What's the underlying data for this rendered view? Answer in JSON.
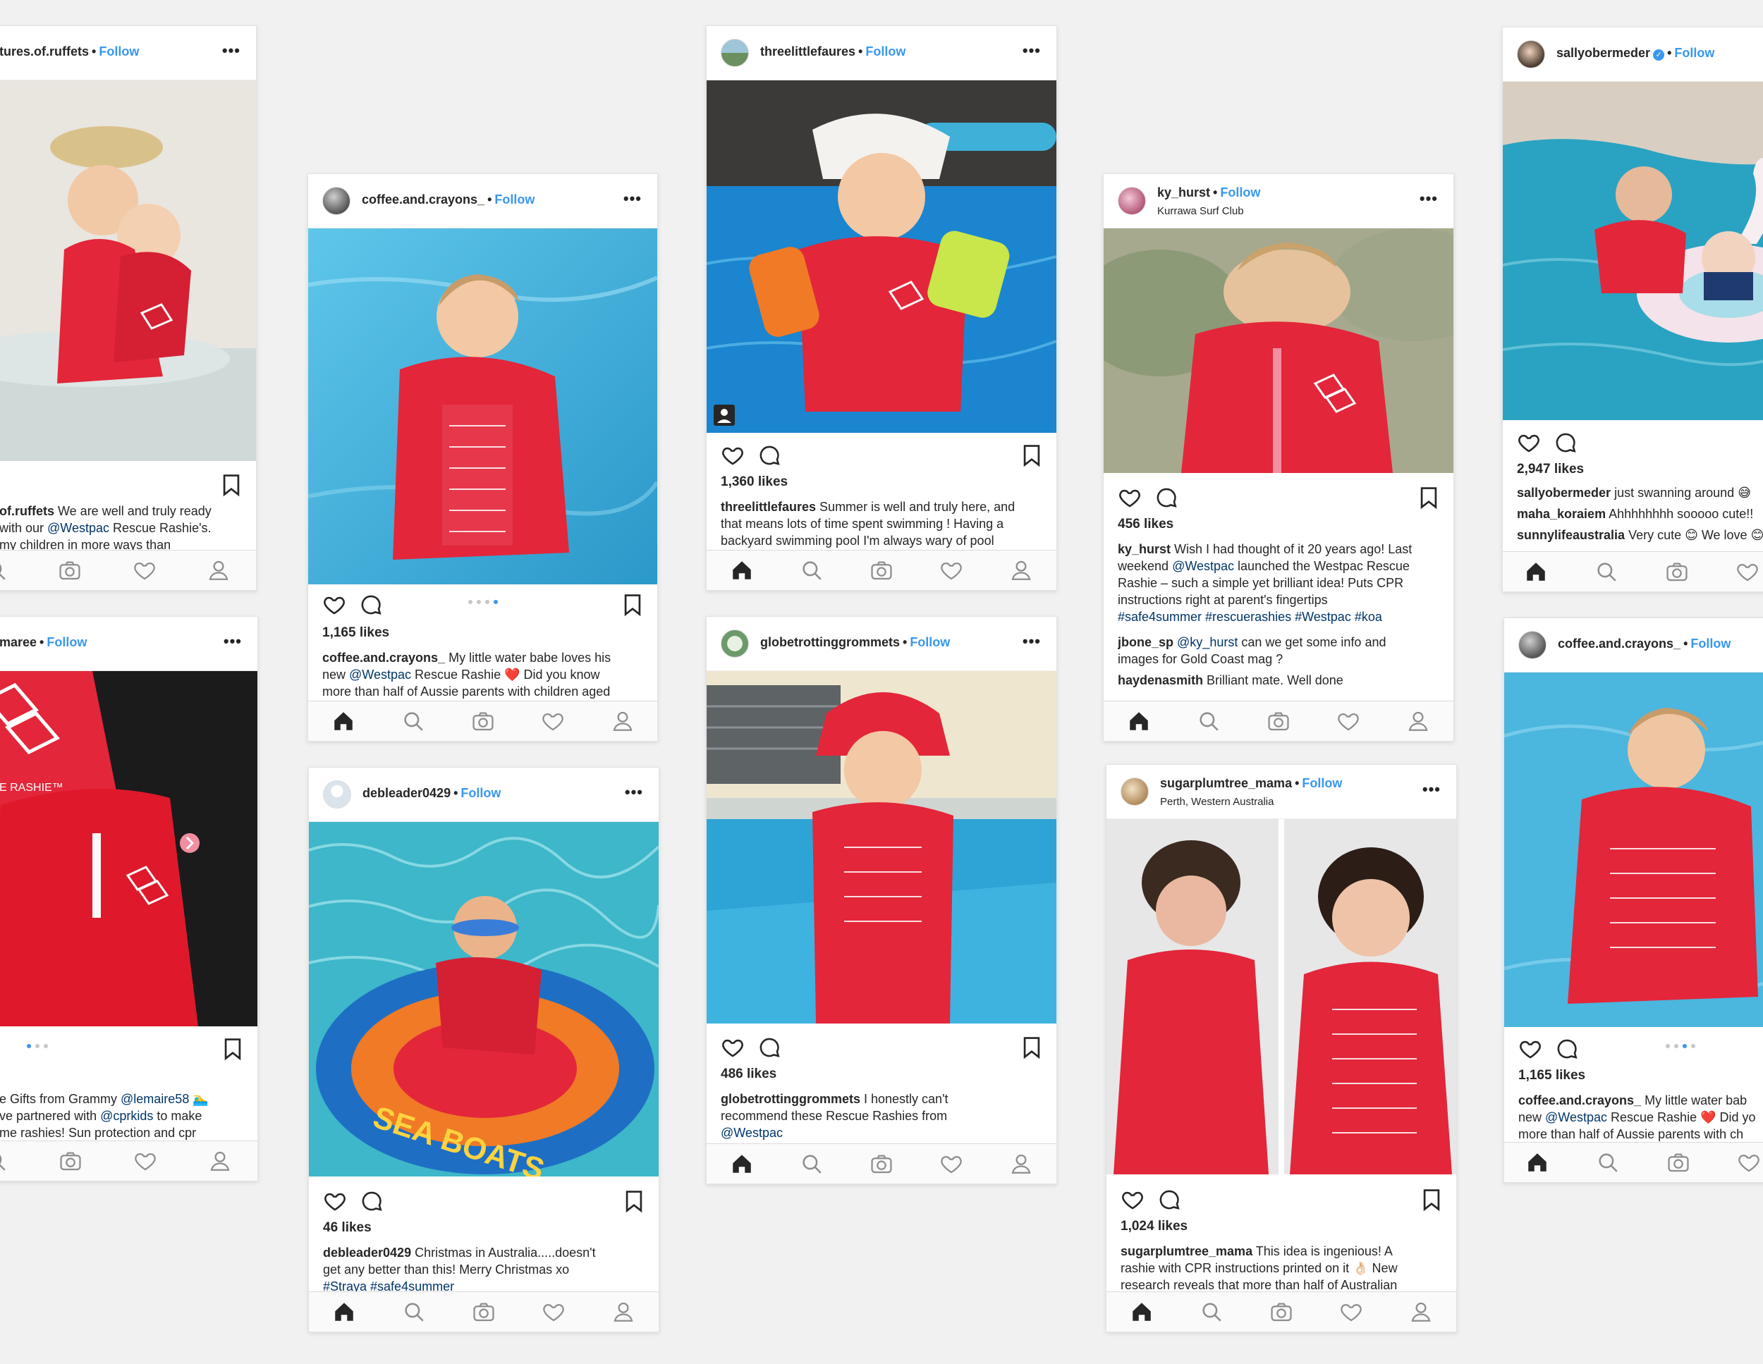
{
  "labels": {
    "follow": "Follow",
    "separator": "•",
    "more": "•••"
  },
  "colors": {
    "background": "#f1f1f1",
    "link": "#3897f0",
    "mention": "#003569",
    "rashie_red": "#e3263a"
  },
  "icons": {
    "heart": "heart-icon",
    "comment": "comment-bubble-icon",
    "save": "bookmark-icon",
    "nav": [
      "home-icon",
      "search-icon",
      "camera-icon",
      "activity-heart-icon",
      "profile-icon"
    ]
  },
  "posts": [
    {
      "username": "tures.of.ruffets",
      "caption_user": "of.ruffets",
      "caption_parts": [
        " We are well and truly ready",
        "with our ",
        "@Westpac",
        " Rescue Rashie's.",
        " my children in more ways than"
      ]
    },
    {
      "username": "maree",
      "caption_parts": [
        "e Gifts from Grammy ",
        "@lemaire58",
        " 🏊‍♂️",
        "ve partnered with ",
        "@cprkids",
        " to make",
        "me rashies! Sun protection and cpr"
      ]
    },
    {
      "username": "coffee.and.crayons_",
      "likes": "1,165 likes",
      "caption_user": "coffee.and.crayons_",
      "caption_parts": [
        " My little water babe loves his",
        "new ",
        "@Westpac",
        " Rescue Rashie ❤️ Did you know",
        "more than half of Aussie parents with children aged"
      ]
    },
    {
      "username": "debleader0429",
      "likes": "46 likes",
      "caption_user": "debleader0429",
      "caption_parts": [
        " Christmas in Australia.....doesn't",
        "get any better than this! Merry Christmas xo",
        "#Straya #safe4summer"
      ]
    },
    {
      "username": "threelittlefaures",
      "likes": "1,360 likes",
      "caption_user": "threelittlefaures",
      "caption_parts": [
        " Summer is well and truly here, and",
        "that means lots of time spent swimming ! Having a",
        "backyard swimming pool I'm always wary of pool"
      ]
    },
    {
      "username": "globetrottinggrommets",
      "likes": "486 likes",
      "caption_user": "globetrottinggrommets",
      "caption_parts": [
        " I honestly can't",
        "recommend these Rescue Rashies from",
        "@Westpac"
      ]
    },
    {
      "username": "ky_hurst",
      "location": "Kurrawa Surf Club",
      "likes": "456 likes",
      "caption_user": "ky_hurst",
      "caption_parts": [
        " Wish I had thought of it 20 years ago! Last",
        "weekend ",
        "@Westpac",
        " launched the Westpac Rescue",
        "Rashie – such a simple yet brilliant idea! Puts CPR",
        "instructions right at parent's fingertips",
        "#safe4summer #rescuerashies #Westpac #koa"
      ],
      "comments": [
        {
          "user": "jbone_sp",
          "mention": "@ky_hurst",
          "text": " can we get some info and",
          "line2": "images for Gold Coast mag ?"
        },
        {
          "user": "haydenasmith",
          "text": " Brilliant mate. Well done"
        }
      ]
    },
    {
      "username": "sugarplumtree_mama",
      "location": "Perth, Western Australia",
      "likes": "1,024 likes",
      "caption_user": "sugarplumtree_mama",
      "caption_parts": [
        " This idea is ingenious! A",
        "rashie with CPR instructions printed on it 👌🏻 New",
        "research reveals that more than half of Australian"
      ]
    },
    {
      "username": "sallyobermeder",
      "likes": "2,947 likes",
      "caption_user": "sallyobermeder",
      "caption_parts": [
        " just swanning around 😅"
      ],
      "comments": [
        {
          "user": "maha_koraiem",
          "text": " Ahhhhhhhh sooooo cute!!"
        },
        {
          "user": "sunnylifeaustralia",
          "text": " Very cute 😊 We love 😊"
        }
      ]
    },
    {
      "username": "coffee.and.crayons_",
      "likes": "1,165 likes",
      "caption_user": "coffee.and.crayons_",
      "caption_parts": [
        " My little water bab",
        "new ",
        "@Westpac",
        " Rescue Rashie ❤️ Did yo",
        "more than half of Aussie parents with ch"
      ]
    }
  ]
}
